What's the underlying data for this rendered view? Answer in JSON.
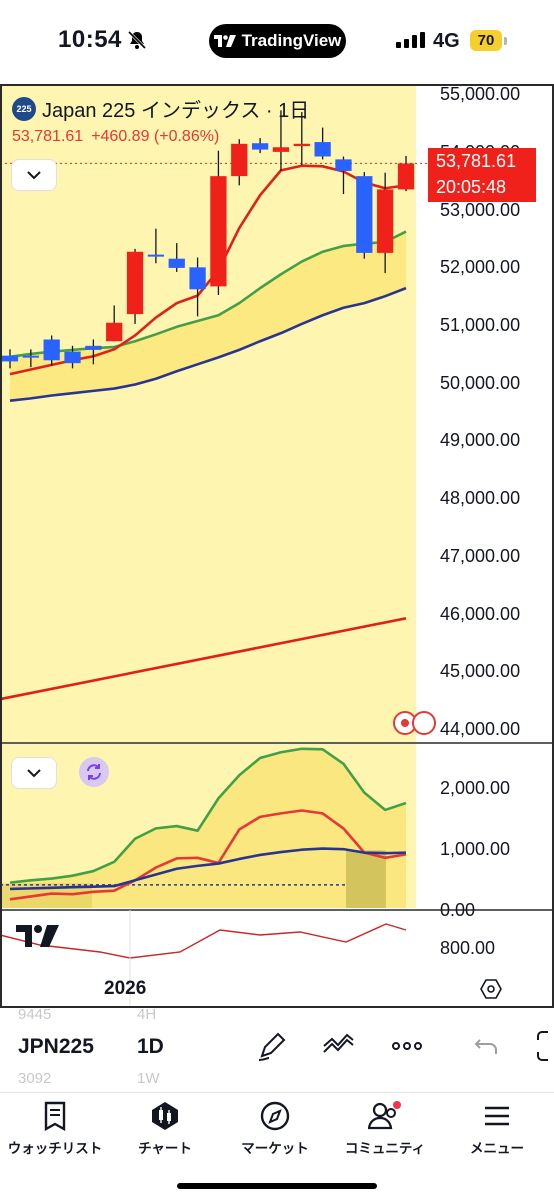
{
  "status_bar": {
    "time": "10:54",
    "app_pill": "TradingView",
    "network": "4G",
    "battery": "70"
  },
  "chart": {
    "symbol_badge": "225",
    "title": "Japan 225 インデックス · 1日",
    "last_price": "53,781.61",
    "change": "+460.89 (+0.86%)",
    "price_tag": {
      "price": "53,781.61",
      "countdown": "20:05:48"
    },
    "x_axis_label": "2026",
    "price_axis": [
      "55,000.00",
      "54,000.00",
      "53,000.00",
      "52,000.00",
      "51,000.00",
      "50,000.00",
      "49,000.00",
      "48,000.00",
      "47,000.00",
      "46,000.00",
      "45,000.00",
      "44,000.00"
    ],
    "indicator_axis": [
      "2,000.00",
      "1,000.00",
      "0.00",
      "800.00"
    ]
  },
  "chart_data": {
    "type": "candlestick",
    "ylim": [
      44000,
      55200
    ],
    "candles": [
      {
        "o": 50450,
        "c": 50350,
        "h": 50560,
        "l": 50230
      },
      {
        "o": 50450,
        "c": 50420,
        "h": 50560,
        "l": 50250
      },
      {
        "o": 50730,
        "c": 50370,
        "h": 50800,
        "l": 50280
      },
      {
        "o": 50520,
        "c": 50320,
        "h": 50620,
        "l": 50230
      },
      {
        "o": 50620,
        "c": 50550,
        "h": 50730,
        "l": 50300
      },
      {
        "o": 50700,
        "c": 51020,
        "h": 51320,
        "l": 50700
      },
      {
        "o": 51170,
        "c": 52250,
        "h": 52300,
        "l": 51000
      },
      {
        "o": 52200,
        "c": 52180,
        "h": 52650,
        "l": 52050
      },
      {
        "o": 52130,
        "c": 51970,
        "h": 52400,
        "l": 51900
      },
      {
        "o": 51980,
        "c": 51600,
        "h": 52150,
        "l": 51130
      },
      {
        "o": 51650,
        "c": 53560,
        "h": 54000,
        "l": 51500
      },
      {
        "o": 53560,
        "c": 54120,
        "h": 54200,
        "l": 53400
      },
      {
        "o": 54130,
        "c": 54020,
        "h": 54220,
        "l": 53960
      },
      {
        "o": 53980,
        "c": 54060,
        "h": 54700,
        "l": 53650
      },
      {
        "o": 54080,
        "c": 54120,
        "h": 54670,
        "l": 53750
      },
      {
        "o": 54150,
        "c": 53900,
        "h": 54400,
        "l": 53850
      },
      {
        "o": 53850,
        "c": 53650,
        "h": 53900,
        "l": 53250
      },
      {
        "o": 53560,
        "c": 52230,
        "h": 53630,
        "l": 52130
      },
      {
        "o": 52230,
        "c": 53330,
        "h": 53620,
        "l": 51880
      },
      {
        "o": 53330,
        "c": 53780,
        "h": 53910,
        "l": 53300
      }
    ],
    "ma_fast": [
      50130,
      50210,
      50290,
      50370,
      50440,
      50560,
      50800,
      51110,
      51360,
      51490,
      51930,
      52660,
      53230,
      53660,
      53740,
      53730,
      53640,
      53450,
      53350,
      53400
    ],
    "ma_mid": [
      50430,
      50480,
      50520,
      50550,
      50580,
      50600,
      50700,
      50820,
      50950,
      51050,
      51150,
      51360,
      51620,
      51860,
      52080,
      52250,
      52350,
      52390,
      52420,
      52600
    ],
    "ma_slow": [
      49670,
      49710,
      49760,
      49800,
      49840,
      49880,
      49950,
      50050,
      50180,
      50300,
      50420,
      50550,
      50700,
      50840,
      51000,
      51150,
      51280,
      51360,
      51480,
      51620
    ],
    "ma_long": {
      "start": 44500,
      "end": 45900
    },
    "indicator": {
      "ylim": [
        0,
        2600
      ],
      "green": [
        440,
        480,
        510,
        560,
        640,
        800,
        1200,
        1380,
        1420,
        1340,
        1900,
        2300,
        2600,
        2700,
        2760,
        2750,
        2500,
        2000,
        1700,
        1820
      ],
      "red": [
        150,
        200,
        250,
        240,
        280,
        300,
        480,
        700,
        860,
        870,
        780,
        1360,
        1580,
        1640,
        1690,
        1640,
        1380,
        960,
        870,
        930
      ],
      "navy": [
        330,
        340,
        350,
        360,
        370,
        380,
        480,
        580,
        680,
        730,
        770,
        850,
        920,
        970,
        1010,
        1030,
        1020,
        960,
        950,
        960
      ]
    }
  },
  "toolbar": {
    "symbol": "JPN225",
    "interval": "1D",
    "ghost_above_symbol": "9445",
    "ghost_above_interval": "4H",
    "ghost_below_symbol": "3092",
    "ghost_below_interval": "1W"
  },
  "tabbar": [
    {
      "label": "ウォッチリスト",
      "icon": "watchlist-icon"
    },
    {
      "label": "チャート",
      "icon": "chart-icon"
    },
    {
      "label": "マーケット",
      "icon": "compass-icon"
    },
    {
      "label": "コミュニティ",
      "icon": "community-icon"
    },
    {
      "label": "メニュー",
      "icon": "menu-icon"
    }
  ],
  "colors": {
    "up": "#f0211a",
    "down": "#2962ff",
    "highlight": "#fdf5b0",
    "ma_green": "#43a047",
    "ma_navy": "#283593"
  }
}
